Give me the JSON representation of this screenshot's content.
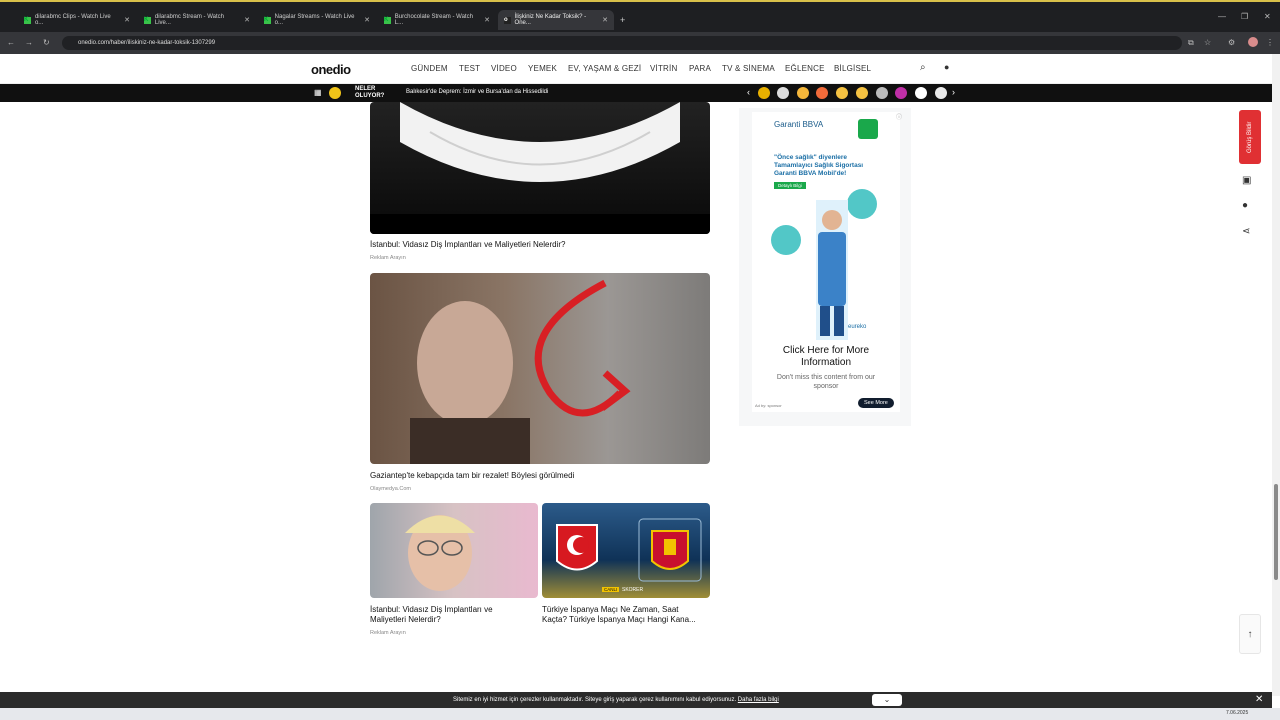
{
  "browser": {
    "tabs": [
      {
        "title": "dilarabmc Clips - Watch Live o..."
      },
      {
        "title": "dilarabmc Stream - Watch Live..."
      },
      {
        "title": "Nagalar Streams - Watch Live o..."
      },
      {
        "title": "Burchocolate Stream - Watch L..."
      },
      {
        "title": "İlişkiniz Ne Kadar Toksik? - One..."
      }
    ],
    "new_tab": "+",
    "url": "onedio.com/haber/iliskiniz-ne-kadar-toksik-1307299"
  },
  "site": {
    "logo": "onedio",
    "nav": [
      "GÜNDEM",
      "TEST",
      "VİDEO",
      "YEMEK",
      "EV, YAŞAM & GEZİ",
      "VİTRİN",
      "PARA",
      "TV & SİNEMA",
      "EĞLENCE",
      "BİLGİSEL"
    ],
    "ticker_label_1": "NELER",
    "ticker_label_2": "OLUYOR?",
    "ticker_text": "Balıkesir'de Deprem: İzmir ve Bursa'dan da Hissedildi"
  },
  "cards": {
    "c1": {
      "title": "İstanbul: Vidasız Diş İmplantları ve Maliyetleri Nelerdir?",
      "source": "Reklam Arayın"
    },
    "c2": {
      "title": "Gaziantep'te kebapçıda tam bir rezalet! Böylesi görülmedi",
      "source": "Olaymedya.Com"
    },
    "c3": {
      "title_1": "İstanbul: Vidasız Diş İmplantları ve",
      "title_2": "Maliyetleri Nelerdir?",
      "source": "Reklam Arayın"
    },
    "c4": {
      "title_1": "Türkiye İspanya Maçı Ne Zaman, Saat",
      "title_2": "Kaçta? Türkiye İspanya Maçı Hangi Kana...",
      "badge_1": "CANLI",
      "badge_2": "SKORER"
    }
  },
  "ad": {
    "brand": "Garanti BBVA",
    "headline_1": "\"Önce sağlık\" diyenlere",
    "headline_2": "Tamamlayıcı Sağlık Sigortası",
    "headline_3": "Garanti BBVA Mobil'de!",
    "cta_small": "Detaylı Bilgi",
    "partner": "eureko",
    "title_1": "Click Here for More",
    "title_2": "Information",
    "desc_1": "Don't miss this content from our",
    "desc_2": "sponsor",
    "by": "Ad by: sponsor",
    "button": "See More"
  },
  "side": {
    "report": "Görüş Bildir",
    "scroll_top": "↑"
  },
  "cookie": {
    "text": "Sitemiz en iyi hizmet için çerezler kullanmaktadır. Siteye giriş yaparak çerez kullanımını kabul ediyorsunuz.",
    "link": "Daha fazla bilgi"
  },
  "taskbar": {
    "date": "7.06.2025"
  },
  "colors": {
    "accent_red": "#e03033",
    "ticker_bg": "#101010",
    "ad_green": "#1aa84b"
  }
}
